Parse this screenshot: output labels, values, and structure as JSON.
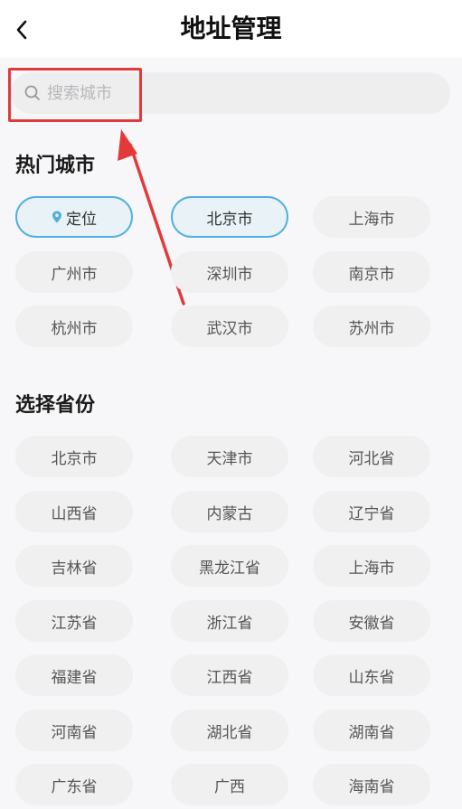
{
  "header": {
    "title": "地址管理"
  },
  "search": {
    "placeholder": "搜索城市"
  },
  "hot": {
    "title": "热门城市",
    "items": [
      {
        "label": "定位",
        "active": true,
        "icon": "location-pin-icon"
      },
      {
        "label": "北京市",
        "active": true
      },
      {
        "label": "上海市"
      },
      {
        "label": "广州市"
      },
      {
        "label": "深圳市"
      },
      {
        "label": "南京市"
      },
      {
        "label": "杭州市"
      },
      {
        "label": "武汉市"
      },
      {
        "label": "苏州市"
      }
    ]
  },
  "province": {
    "title": "选择省份",
    "items": [
      {
        "label": "北京市"
      },
      {
        "label": "天津市"
      },
      {
        "label": "河北省"
      },
      {
        "label": "山西省"
      },
      {
        "label": "内蒙古"
      },
      {
        "label": "辽宁省"
      },
      {
        "label": "吉林省"
      },
      {
        "label": "黑龙江省"
      },
      {
        "label": "上海市"
      },
      {
        "label": "江苏省"
      },
      {
        "label": "浙江省"
      },
      {
        "label": "安徽省"
      },
      {
        "label": "福建省"
      },
      {
        "label": "江西省"
      },
      {
        "label": "山东省"
      },
      {
        "label": "河南省"
      },
      {
        "label": "湖北省"
      },
      {
        "label": "湖南省"
      },
      {
        "label": "广东省"
      },
      {
        "label": "广西"
      },
      {
        "label": "海南省"
      }
    ]
  },
  "colors": {
    "accent": "#4fb0df",
    "annotation": "#e23a3a"
  }
}
